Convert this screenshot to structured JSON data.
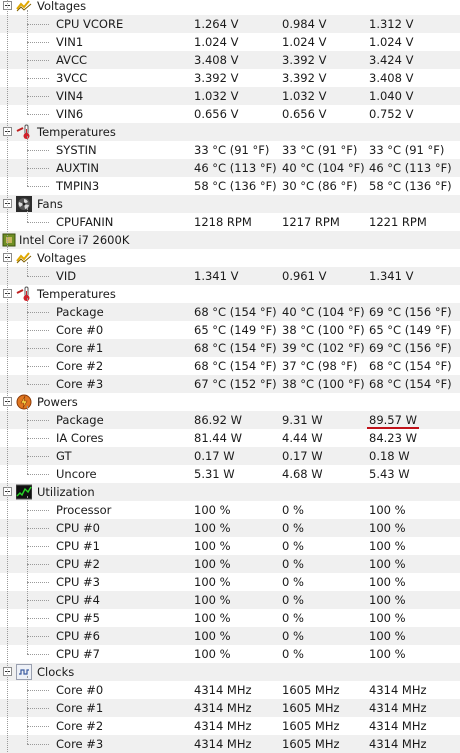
{
  "groups": [
    {
      "kind": "sensor-group",
      "icon": "voltage-icon",
      "label": "Voltages",
      "rows": [
        [
          "CPU VCORE",
          "1.264 V",
          "0.984 V",
          "1.312 V"
        ],
        [
          "VIN1",
          "1.024 V",
          "1.024 V",
          "1.024 V"
        ],
        [
          "AVCC",
          "3.408 V",
          "3.392 V",
          "3.424 V"
        ],
        [
          "3VCC",
          "3.392 V",
          "3.392 V",
          "3.408 V"
        ],
        [
          "VIN4",
          "1.032 V",
          "1.032 V",
          "1.040 V"
        ],
        [
          "VIN6",
          "0.656 V",
          "0.656 V",
          "0.752 V"
        ]
      ]
    },
    {
      "kind": "sensor-group",
      "icon": "temperature-icon",
      "label": "Temperatures",
      "rows": [
        [
          "SYSTIN",
          "33 °C  (91 °F)",
          "33 °C  (91 °F)",
          "33 °C  (91 °F)"
        ],
        [
          "AUXTIN",
          "46 °C  (113 °F)",
          "40 °C  (104 °F)",
          "46 °C  (113 °F)"
        ],
        [
          "TMPIN3",
          "58 °C  (136 °F)",
          "30 °C  (86 °F)",
          "58 °C  (136 °F)"
        ]
      ]
    },
    {
      "kind": "sensor-group",
      "icon": "fan-icon",
      "label": "Fans",
      "rows": [
        [
          "CPUFANIN",
          "1218 RPM",
          "1217 RPM",
          "1221 RPM"
        ]
      ]
    },
    {
      "kind": "device",
      "icon": "cpu-chip-icon",
      "label": "Intel Core i7 2600K",
      "rows": []
    },
    {
      "kind": "sensor-group",
      "icon": "voltage-icon",
      "label": "Voltages",
      "rows": [
        [
          "VID",
          "1.341 V",
          "0.961 V",
          "1.341 V"
        ]
      ]
    },
    {
      "kind": "sensor-group",
      "icon": "temperature-icon",
      "label": "Temperatures",
      "rows": [
        [
          "Package",
          "68 °C  (154 °F)",
          "40 °C  (104 °F)",
          "69 °C  (156 °F)"
        ],
        [
          "Core #0",
          "65 °C  (149 °F)",
          "38 °C  (100 °F)",
          "65 °C  (149 °F)"
        ],
        [
          "Core #1",
          "68 °C  (154 °F)",
          "39 °C  (102 °F)",
          "69 °C  (156 °F)"
        ],
        [
          "Core #2",
          "68 °C  (154 °F)",
          "37 °C  (98 °F)",
          "68 °C  (154 °F)"
        ],
        [
          "Core #3",
          "67 °C  (152 °F)",
          "38 °C  (100 °F)",
          "68 °C  (154 °F)"
        ]
      ]
    },
    {
      "kind": "sensor-group",
      "icon": "power-icon",
      "label": "Powers",
      "rows": [
        [
          "Package",
          "86.92 W",
          "9.31 W",
          "89.57 W"
        ],
        [
          "IA Cores",
          "81.44 W",
          "4.44 W",
          "84.23 W"
        ],
        [
          "GT",
          "0.17 W",
          "0.17 W",
          "0.18 W"
        ],
        [
          "Uncore",
          "5.31 W",
          "4.68 W",
          "5.43 W"
        ]
      ]
    },
    {
      "kind": "sensor-group",
      "icon": "utilization-icon",
      "label": "Utilization",
      "rows": [
        [
          "Processor",
          "100 %",
          "0 %",
          "100 %"
        ],
        [
          "CPU #0",
          "100 %",
          "0 %",
          "100 %"
        ],
        [
          "CPU #1",
          "100 %",
          "0 %",
          "100 %"
        ],
        [
          "CPU #2",
          "100 %",
          "0 %",
          "100 %"
        ],
        [
          "CPU #3",
          "100 %",
          "0 %",
          "100 %"
        ],
        [
          "CPU #4",
          "100 %",
          "0 %",
          "100 %"
        ],
        [
          "CPU #5",
          "100 %",
          "0 %",
          "100 %"
        ],
        [
          "CPU #6",
          "100 %",
          "0 %",
          "100 %"
        ],
        [
          "CPU #7",
          "100 %",
          "0 %",
          "100 %"
        ]
      ]
    },
    {
      "kind": "sensor-group",
      "icon": "clock-icon",
      "label": "Clocks",
      "rows": [
        [
          "Core #0",
          "4314 MHz",
          "1605 MHz",
          "4314 MHz"
        ],
        [
          "Core #1",
          "4314 MHz",
          "1605 MHz",
          "4314 MHz"
        ],
        [
          "Core #2",
          "4314 MHz",
          "1605 MHz",
          "4314 MHz"
        ],
        [
          "Core #3",
          "4314 MHz",
          "1605 MHz",
          "4314 MHz"
        ]
      ]
    }
  ],
  "highlight": {
    "group": 6,
    "row": 0,
    "column": "max",
    "color": "#c0121a"
  },
  "colors": {
    "stripe": "#f0f0f0",
    "background": "#ffffff",
    "text": "#1a1a1a"
  }
}
